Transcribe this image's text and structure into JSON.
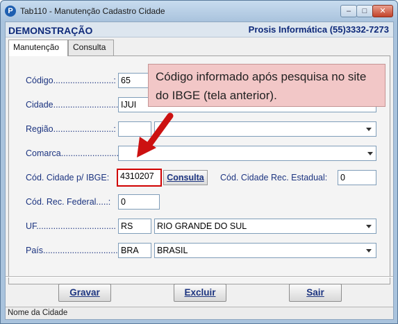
{
  "window": {
    "title": "Tab110 - Manutenção Cadastro Cidade",
    "app_icon_letter": "P"
  },
  "header": {
    "left": "DEMONSTRAÇÃO",
    "right": "Prosis Informática (55)3332-7273"
  },
  "tabs": [
    {
      "label": "Manutenção",
      "active": true
    },
    {
      "label": "Consulta",
      "active": false
    }
  ],
  "form": {
    "codigo": {
      "label": "Código.........................:",
      "value": "65"
    },
    "cidade": {
      "label": "Cidade...........................",
      "value": "IJUI"
    },
    "regiao": {
      "label": "Região.........................:",
      "value": ""
    },
    "comarca": {
      "label": "Comarca........................:",
      "value": ""
    },
    "cod_ibge": {
      "label": "Cód. Cidade p/ IBGE:",
      "value": "4310207",
      "button": "Consulta"
    },
    "cod_estadual": {
      "label": "Cód. Cidade Rec. Estadual:",
      "value": "0"
    },
    "cod_federal": {
      "label": "Cód. Rec. Federal.....:",
      "value": "0"
    },
    "uf": {
      "label": "UF.................................",
      "code": "RS",
      "name": "RIO GRANDE DO SUL"
    },
    "pais": {
      "label": "País...............................",
      "code": "BRA",
      "name": "BRASIL"
    }
  },
  "callout": {
    "text": "Código informado após pesquisa no site do IBGE (tela anterior).",
    "color": "#f2c7c7"
  },
  "buttons": {
    "gravar": "Gravar",
    "excluir": "Excluir",
    "sair": "Sair"
  },
  "statusbar": {
    "text": "Nome da Cidade"
  },
  "colors": {
    "label": "#1c3480",
    "highlight": "#d00000",
    "arrow": "#cc1111"
  }
}
